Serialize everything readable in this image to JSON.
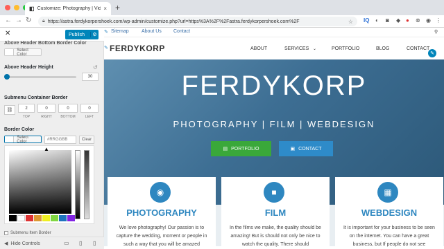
{
  "browser": {
    "tab_title": "Customize: Photography | Vid...",
    "url": "https://astra.ferdykorpershoek.com/wp-admin/customize.php?url=https%3A%2F%2Fastra.ferdykorpershoek.com%2F",
    "new_tab": "+",
    "close_tab": "×"
  },
  "sidebar": {
    "close": "✕",
    "publish": "Publish",
    "publish_gear": "⚙",
    "sections": {
      "bottom_border_color": "Above Header Bottom Border Color",
      "header_height": "Above Header Height",
      "submenu_border": "Submenu Container Border",
      "border_color": "Border Color",
      "submenu_item_border": "Submenu Item Border"
    },
    "select_color": "Select Color",
    "height_value": "30",
    "border_values": {
      "top": "2",
      "right": "0",
      "bottom": "0",
      "left": "0"
    },
    "border_labels": {
      "top": "TOP",
      "right": "RIGHT",
      "bottom": "BOTTOM",
      "left": "LEFT"
    },
    "hex_placeholder": "#RRGGBB",
    "clear": "Clear",
    "hide_controls": "Hide Controls",
    "palette": [
      "#000000",
      "#ffffff",
      "#dd3333",
      "#dd9933",
      "#eeee22",
      "#81d742",
      "#1e73be",
      "#8224e3"
    ]
  },
  "site": {
    "top_links": [
      "Sitemap",
      "About Us",
      "Contact"
    ],
    "logo": "FERDYKORP",
    "menu": [
      "ABOUT",
      "SERVICES",
      "PORTFOLIO",
      "BLOG",
      "CONTACT"
    ],
    "hero_title": "FERDYKORP",
    "hero_subtitle": "PHOTOGRAPHY | FILM | WEBDESIGN",
    "btn_portfolio": "PORTFOLIO",
    "btn_contact": "CONTACT",
    "cards": [
      {
        "title": "PHOTOGRAPHY",
        "text": "We love photography! Our passion is to capture the wedding, moment or people in such a way that you will be amazed"
      },
      {
        "title": "FILM",
        "text": "In the films we make, the quality should be amazing! But is should not only be nice to watch the quality. There should"
      },
      {
        "title": "WEBDESIGN",
        "text": "It is important for your business to be seen on the internet. You can have a great business, but If people do not see"
      }
    ]
  }
}
